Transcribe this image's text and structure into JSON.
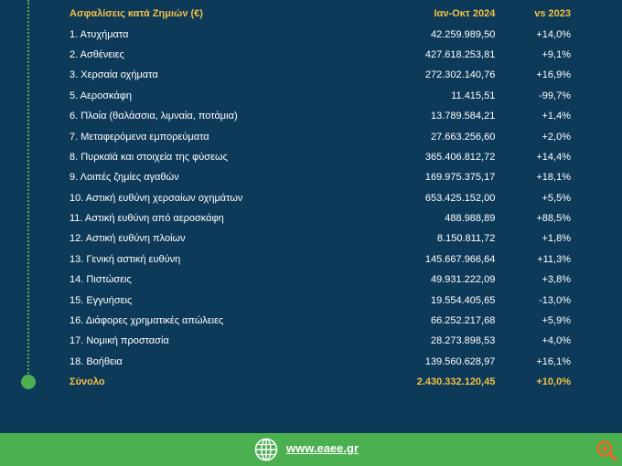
{
  "table": {
    "headers": {
      "category": "Ασφαλίσεις κατά Ζημιών (€)",
      "period": "Ιαν-Οκτ 2024",
      "change": "vs 2023"
    },
    "rows": [
      {
        "label": "1. Ατυχήματα",
        "value": "42.259.989,50",
        "change": "+14,0%"
      },
      {
        "label": "2. Ασθένειες",
        "value": "427.618.253,81",
        "change": "+9,1%"
      },
      {
        "label": "3. Χερσαία οχήματα",
        "value": "272.302.140,76",
        "change": "+16,9%"
      },
      {
        "label": "5. Αεροσκάφη",
        "value": "11.415,51",
        "change": "-99,7%"
      },
      {
        "label": "6. Πλοία (θαλάσσια, λιμναία, ποτάμια)",
        "value": "13.789.584,21",
        "change": "+1,4%"
      },
      {
        "label": "7. Μεταφερόμενα εμπορεύματα",
        "value": "27.663.256,60",
        "change": "+2,0%"
      },
      {
        "label": "8. Πυρκαϊά και στοιχεία της φύσεως",
        "value": "365.406.812,72",
        "change": "+14,4%"
      },
      {
        "label": "9. Λοιπές ζημίες αγαθών",
        "value": "169.975.375,17",
        "change": "+18,1%"
      },
      {
        "label": "10. Αστική ευθύνη χερσαίων οχημάτων",
        "value": "653.425.152,00",
        "change": "+5,5%"
      },
      {
        "label": "11. Αστική ευθύνη από αεροσκάφη",
        "value": "488.988,89",
        "change": "+88,5%"
      },
      {
        "label": "12. Αστική ευθύνη πλοίων",
        "value": "8.150.811,72",
        "change": "+1,8%"
      },
      {
        "label": "13. Γενική αστική ευθύνη",
        "value": "145.667.966,64",
        "change": "+11,3%"
      },
      {
        "label": "14. Πιστώσεις",
        "value": "49.931.222,09",
        "change": "+3,8%"
      },
      {
        "label": "15. Εγγυήσεις",
        "value": "19.554.405,65",
        "change": "-13,0%"
      },
      {
        "label": "16. Διάφορες χρηματικές απώλειες",
        "value": "66.252.217,68",
        "change": "+5,9%"
      },
      {
        "label": "17. Νομική προστασία",
        "value": "28.273.898,53",
        "change": "+4,0%"
      },
      {
        "label": "18. Βοήθεια",
        "value": "139.560.628,97",
        "change": "+16,1%"
      }
    ],
    "total": {
      "label": "Σύνολο",
      "value": "2.430.332.120,45",
      "change": "+10,0%"
    }
  },
  "footer": {
    "website": "www.eaee.gr",
    "globe_icon": "globe-icon"
  },
  "zoom_icon": "zoom-in-icon",
  "colors": {
    "background": "#0e3a5a",
    "accent": "#f3c045",
    "footer": "#4caf50",
    "text": "#ffffff"
  }
}
